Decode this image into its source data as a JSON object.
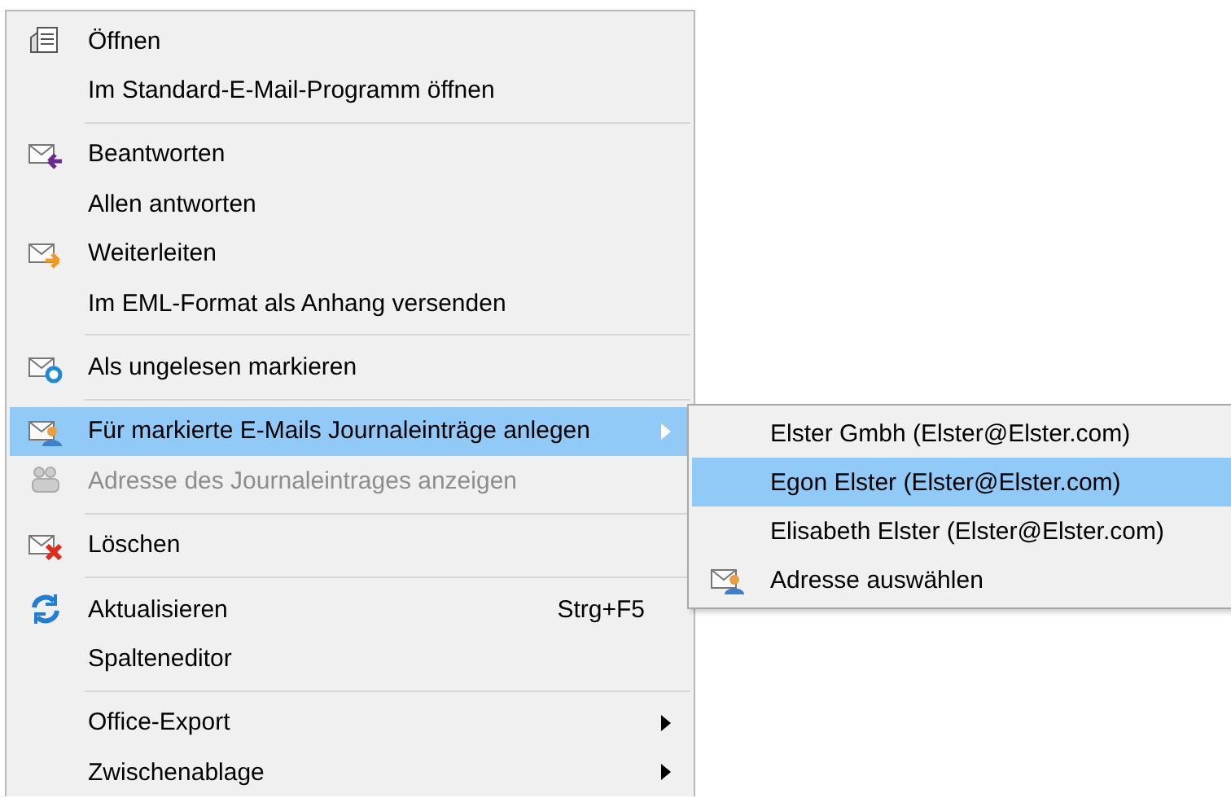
{
  "context_menu": {
    "items": [
      {
        "kind": "item",
        "label": "Öffnen",
        "selected": false,
        "disabled": false
      },
      {
        "kind": "item",
        "label": "Im Standard-E-Mail-Programm öffnen",
        "selected": false,
        "disabled": false
      },
      {
        "kind": "separator"
      },
      {
        "kind": "item",
        "label": "Beantworten",
        "selected": false,
        "disabled": false
      },
      {
        "kind": "item",
        "label": "Allen antworten",
        "selected": false,
        "disabled": false
      },
      {
        "kind": "item",
        "label": "Weiterleiten",
        "selected": false,
        "disabled": false
      },
      {
        "kind": "item",
        "label": "Im EML-Format als Anhang versenden",
        "selected": false,
        "disabled": false
      },
      {
        "kind": "separator"
      },
      {
        "kind": "item",
        "label": "Als ungelesen markieren",
        "selected": false,
        "disabled": false
      },
      {
        "kind": "separator"
      },
      {
        "kind": "submenu",
        "label": "Für markierte E-Mails Journaleinträge anlegen",
        "selected": true,
        "disabled": false
      },
      {
        "kind": "item",
        "label": "Adresse des Journaleintrages anzeigen",
        "selected": false,
        "disabled": true
      },
      {
        "kind": "separator"
      },
      {
        "kind": "item",
        "label": "Löschen",
        "selected": false,
        "disabled": false
      },
      {
        "kind": "separator"
      },
      {
        "kind": "item",
        "label": "Aktualisieren",
        "shortcut": "Strg+F5",
        "selected": false,
        "disabled": false
      },
      {
        "kind": "item",
        "label": "Spalteneditor",
        "selected": false,
        "disabled": false
      },
      {
        "kind": "separator"
      },
      {
        "kind": "submenu",
        "label": "Office-Export",
        "selected": false,
        "disabled": false
      },
      {
        "kind": "submenu",
        "label": "Zwischenablage",
        "selected": false,
        "disabled": false
      }
    ]
  },
  "submenu": {
    "items": [
      {
        "label": "Elster Gmbh (Elster@Elster.com)",
        "selected": false
      },
      {
        "label": "Egon Elster (Elster@Elster.com)",
        "selected": true
      },
      {
        "label": "Elisabeth Elster (Elster@Elster.com)",
        "selected": false
      },
      {
        "label": "Adresse auswählen",
        "selected": false
      }
    ]
  }
}
